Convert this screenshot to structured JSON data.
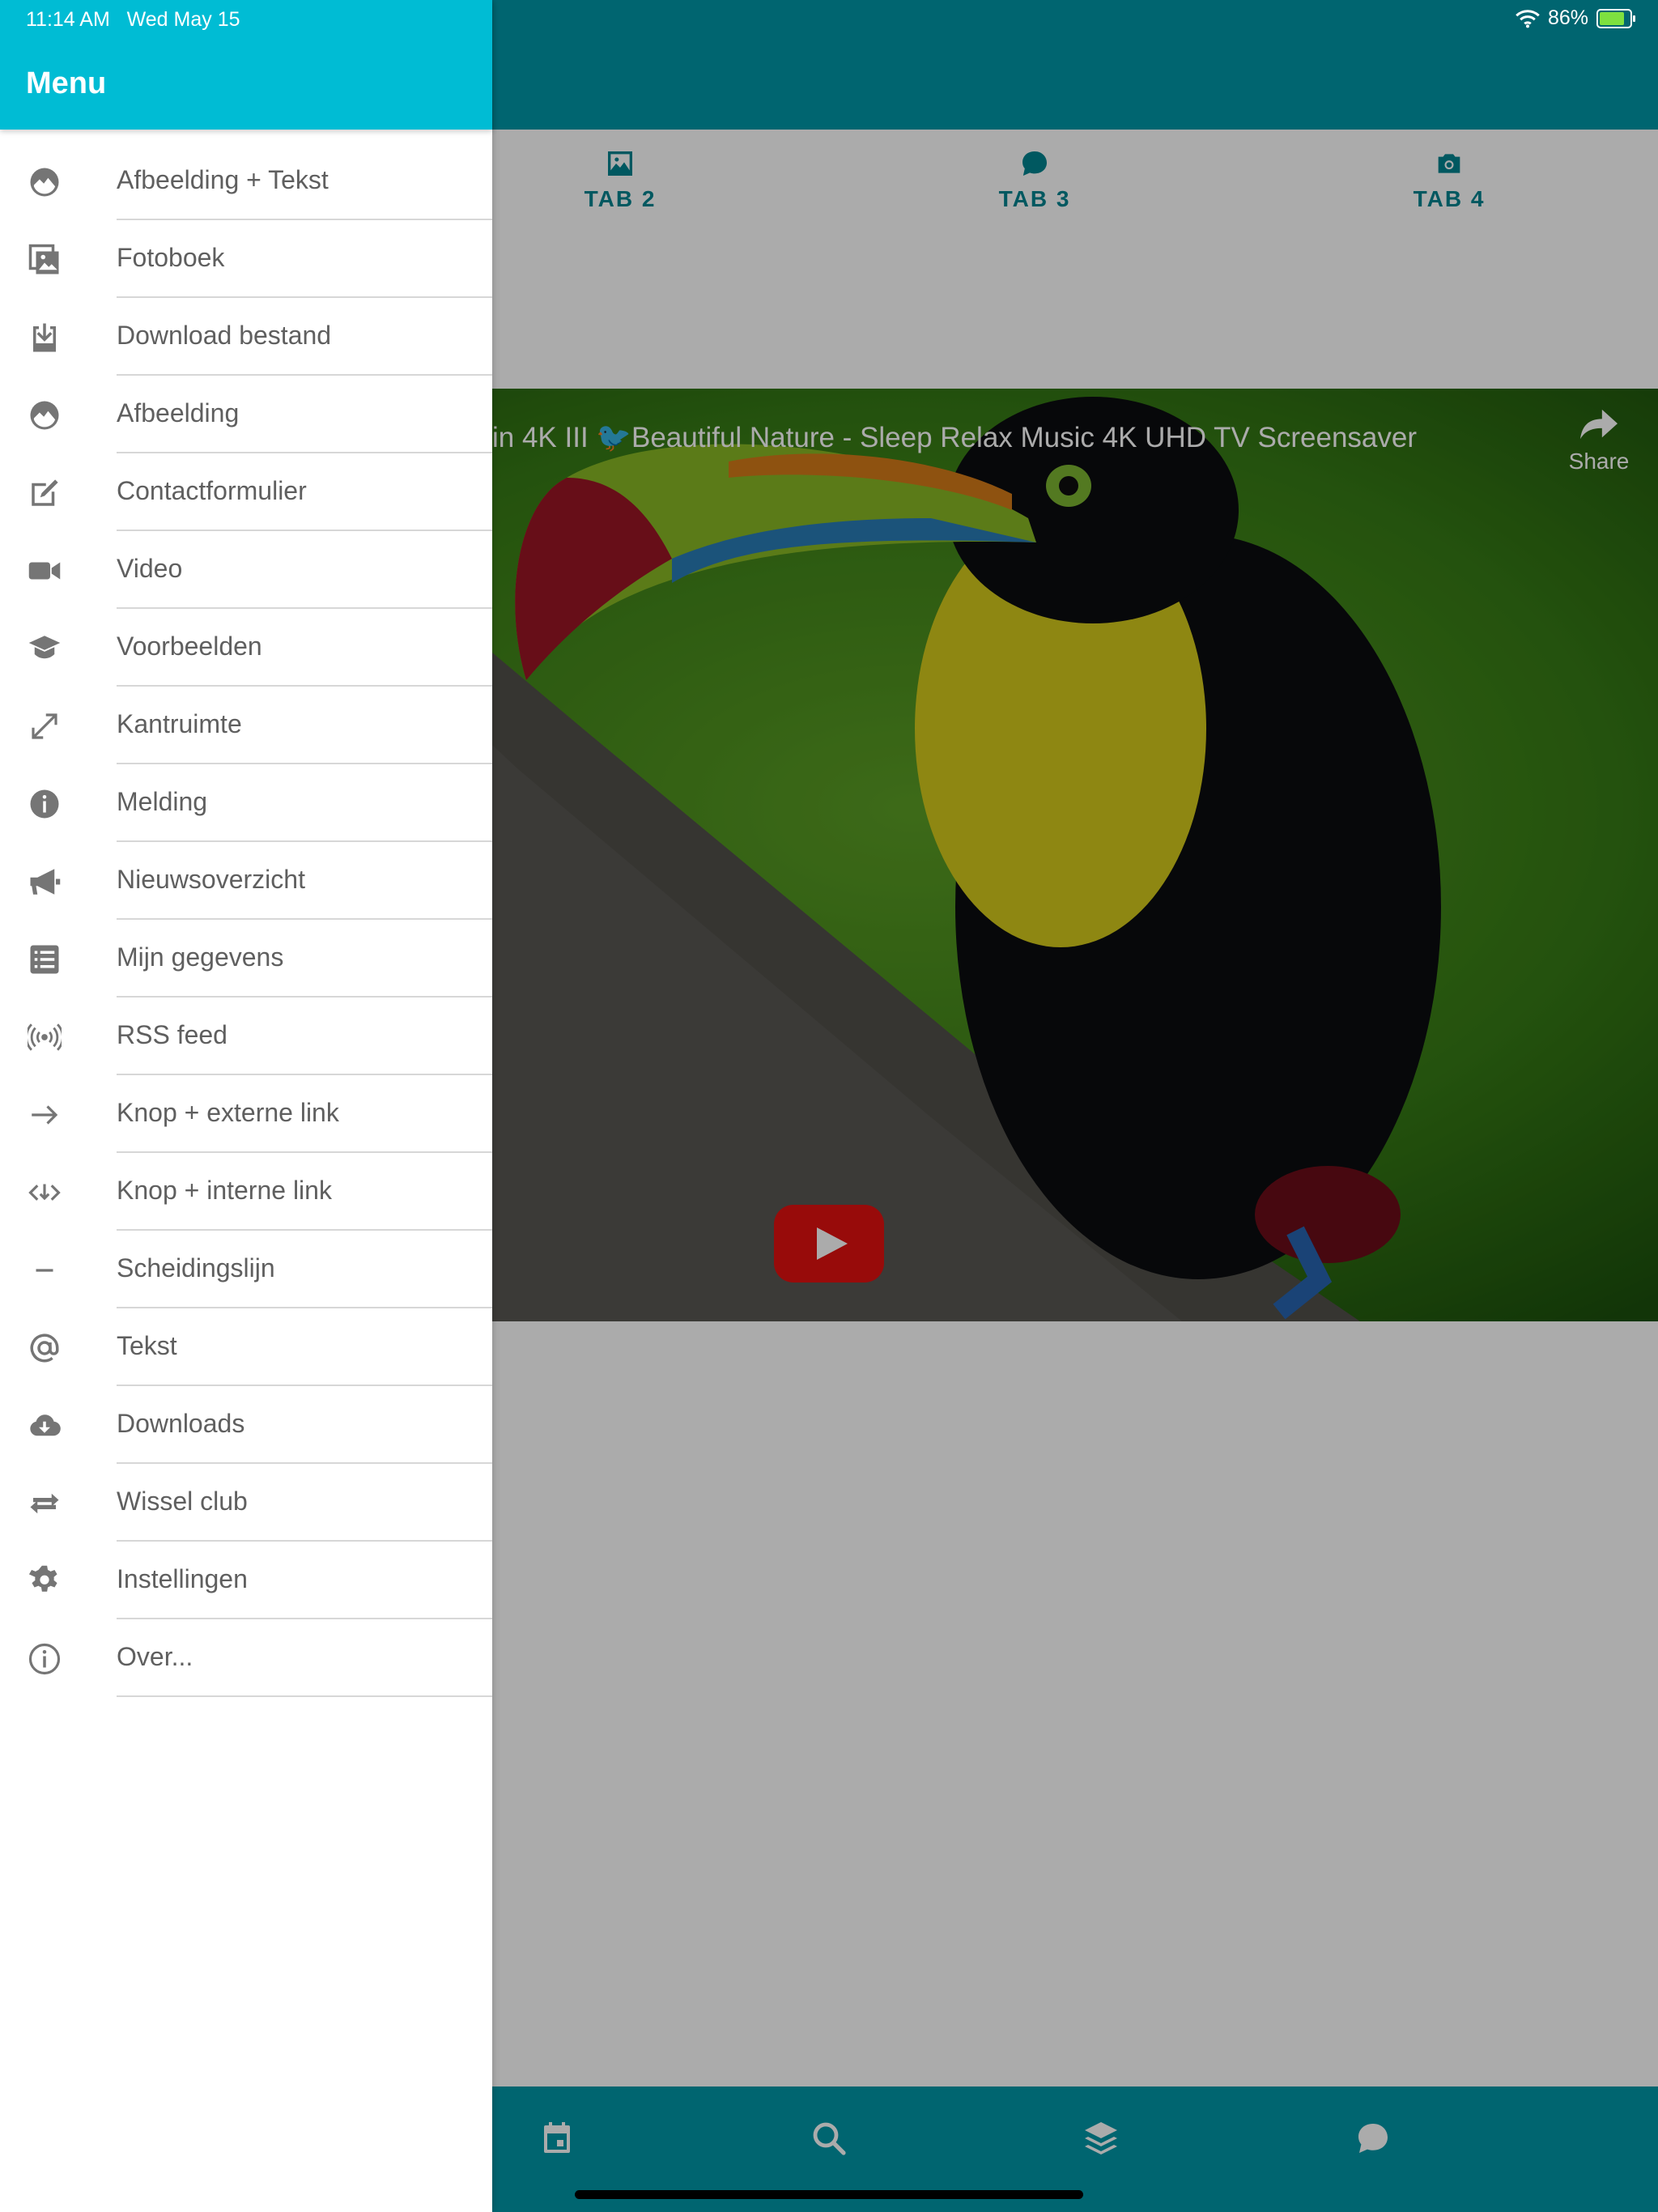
{
  "status_bar": {
    "time": "11:14 AM",
    "date": "Wed May 15",
    "battery": "86%"
  },
  "drawer": {
    "title": "Menu",
    "items": [
      {
        "label": "Afbeelding + Tekst",
        "icon": "image-icon"
      },
      {
        "label": "Fotoboek",
        "icon": "photo-album-icon"
      },
      {
        "label": "Download bestand",
        "icon": "download-file-icon"
      },
      {
        "label": "Afbeelding",
        "icon": "image-icon"
      },
      {
        "label": "Contactformulier",
        "icon": "edit-form-icon"
      },
      {
        "label": "Video",
        "icon": "video-camera-icon"
      },
      {
        "label": "Voorbeelden",
        "icon": "graduation-cap-icon"
      },
      {
        "label": "Kantruimte",
        "icon": "expand-arrows-icon"
      },
      {
        "label": "Melding",
        "icon": "info-circle-icon"
      },
      {
        "label": "Nieuwsoverzicht",
        "icon": "megaphone-icon"
      },
      {
        "label": "Mijn gegevens",
        "icon": "list-icon"
      },
      {
        "label": "RSS feed",
        "icon": "broadcast-icon"
      },
      {
        "label": "Knop + externe link",
        "icon": "arrow-right-icon"
      },
      {
        "label": "Knop + interne link",
        "icon": "code-arrows-icon"
      },
      {
        "label": "Scheidingslijn",
        "icon": "minus-icon"
      },
      {
        "label": "Tekst",
        "icon": "at-sign-icon"
      },
      {
        "label": "Downloads",
        "icon": "cloud-download-icon"
      },
      {
        "label": "Wissel club",
        "icon": "swap-arrows-icon"
      },
      {
        "label": "Instellingen",
        "icon": "gear-icon"
      },
      {
        "label": "Over...",
        "icon": "info-outline-icon"
      }
    ]
  },
  "tabs": [
    {
      "label": "TAB 2",
      "icon": "image-icon"
    },
    {
      "label": "TAB 3",
      "icon": "chat-icon"
    },
    {
      "label": "TAB 4",
      "icon": "camera-icon"
    }
  ],
  "video": {
    "title": "in 4K III 🐦Beautiful Nature - Sleep Relax Music 4K UHD TV Screensaver",
    "share_label": "Share"
  },
  "bottom_nav": [
    {
      "icon": "calendar-icon"
    },
    {
      "icon": "search-icon"
    },
    {
      "icon": "layers-icon"
    },
    {
      "icon": "chat-icon"
    }
  ],
  "colors": {
    "header": "#0097a7",
    "drawer_header": "#00bcd4",
    "tab_text": "#00838f",
    "play_button": "#e3110f"
  }
}
